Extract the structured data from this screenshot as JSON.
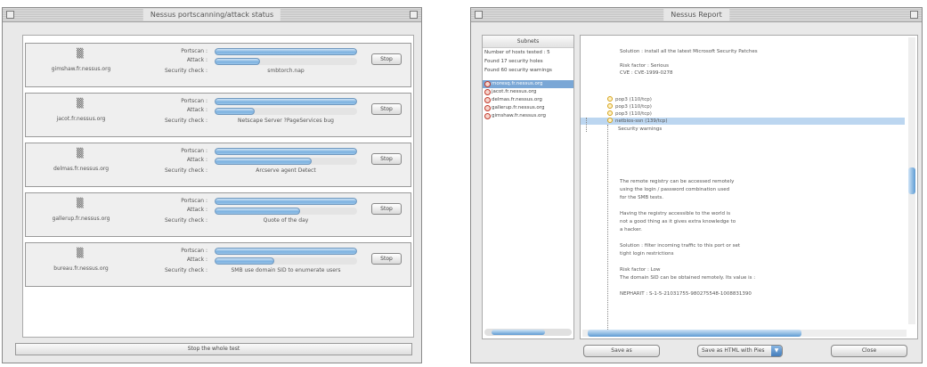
{
  "left_window": {
    "title": "Nessus portscanning/attack status",
    "labels": {
      "portscan": "Portscan :",
      "attack": "Attack :",
      "security": "Security check :"
    },
    "stop_label": "Stop",
    "stop_whole_label": "Stop the whole test",
    "hosts": [
      {
        "name": "gimshaw.fr.nessus.org",
        "portscan_progress": 1.0,
        "attack_progress": 0.32,
        "security_check": "smbtorch.nap"
      },
      {
        "name": "jacot.fr.nessus.org",
        "portscan_progress": 1.0,
        "attack_progress": 0.28,
        "security_check": "Netscape Server ?PageServices bug"
      },
      {
        "name": "delmas.fr.nessus.org",
        "portscan_progress": 1.0,
        "attack_progress": 0.68,
        "security_check": "Arcserve agent Detect"
      },
      {
        "name": "gallerup.fr.nessus.org",
        "portscan_progress": 1.0,
        "attack_progress": 0.6,
        "security_check": "Quote of the day"
      },
      {
        "name": "bureau.fr.nessus.org",
        "portscan_progress": 1.0,
        "attack_progress": 0.42,
        "security_check": "SMB use domain SID to enumerate users"
      }
    ]
  },
  "right_window": {
    "title": "Nessus Report",
    "list_header": "Subnets",
    "summary_lines": [
      "Number of hosts tested : 5",
      "Found 17 security holes",
      "Found 60 security warnings"
    ],
    "hosts": [
      {
        "name": "moresq.fr.nessus.org"
      },
      {
        "name": "jacot.fr.nessus.org"
      },
      {
        "name": "delmas.fr.nessus.org"
      },
      {
        "name": "gallerup.fr.nessus.org"
      },
      {
        "name": "gimshaw.fr.nessus.org"
      }
    ],
    "selected_host_index": 0,
    "report_top": [
      "Solution : install all the latest Microsoft Security Patches",
      "",
      "Risk factor : Serious",
      "CVE : CVE-1999-0278"
    ],
    "ports": [
      "pop3 (110/tcp)",
      "pop3 (110/tcp)",
      "pop3 (110/tcp)",
      "netbios-ssn (139/tcp)"
    ],
    "selected_port_index": 3,
    "severity": "Security warnings",
    "report_body": [
      "The remote registry can be accessed remotely",
      "using the login / password combination used",
      "for the SMB tests.",
      "",
      "Having the registry accessible to the world is",
      "not a good thing as it gives extra knowledge to",
      "a hacker.",
      "",
      "Solution : filter incoming traffic to this port or set",
      "tight login restrictions",
      "",
      "Risk factor : Low",
      "The domain SID can be obtained remotely. Its value is :",
      "",
      "NEPHARIT : S-1-5-21031755-980275548-1008831390"
    ],
    "save_label": "Save as",
    "format_value": "Save as HTML with Pies",
    "close_label": "Close"
  },
  "icons": {
    "host_icon": "network-host-icon",
    "warning_icon": "warning-circle-icon",
    "port_icon": "port-warning-icon"
  }
}
